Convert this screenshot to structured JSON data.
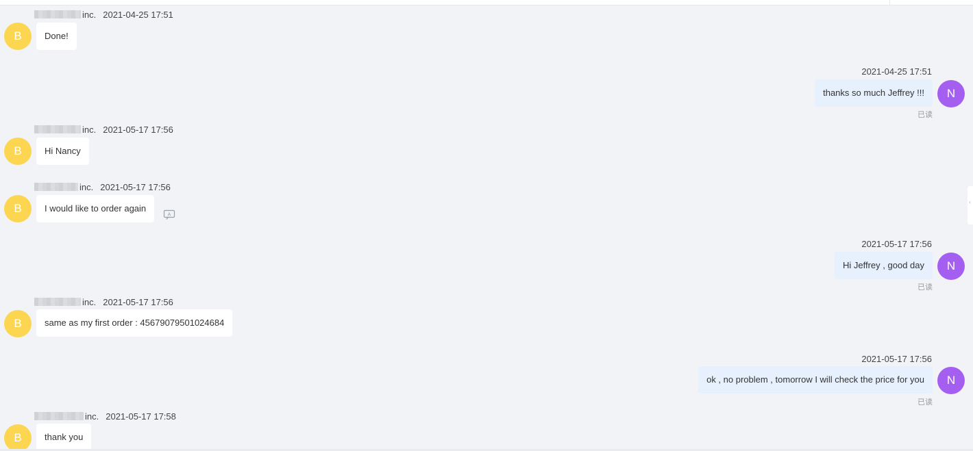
{
  "contact": {
    "company_suffix": "inc.",
    "avatar_letter": "B",
    "avatar_color": "#fcd651"
  },
  "me": {
    "avatar_letter": "N",
    "avatar_color": "#a55ff0"
  },
  "read_label": "已读",
  "messages": [
    {
      "direction": "in",
      "time": "2021-04-25 17:51",
      "text": "Done!"
    },
    {
      "direction": "out",
      "time": "2021-04-25 17:51",
      "text": "thanks so much Jeffrey !!!"
    },
    {
      "direction": "in",
      "time": "2021-05-17 17:56",
      "text": "Hi Nancy"
    },
    {
      "direction": "in",
      "time": "2021-05-17 17:56",
      "text": "I would like to order again",
      "suffix_sep": ", "
    },
    {
      "direction": "out",
      "time": "2021-05-17 17:56",
      "text": "Hi Jeffrey , good day"
    },
    {
      "direction": "in",
      "time": "2021-05-17 17:56",
      "text": "same as my first order : 45679079501024684"
    },
    {
      "direction": "out",
      "time": "2021-05-17 17:56",
      "text": "ok , no problem , tomorrow I will check the price for you"
    },
    {
      "direction": "in",
      "time": "2021-05-17 17:58",
      "text": "thank you"
    }
  ]
}
